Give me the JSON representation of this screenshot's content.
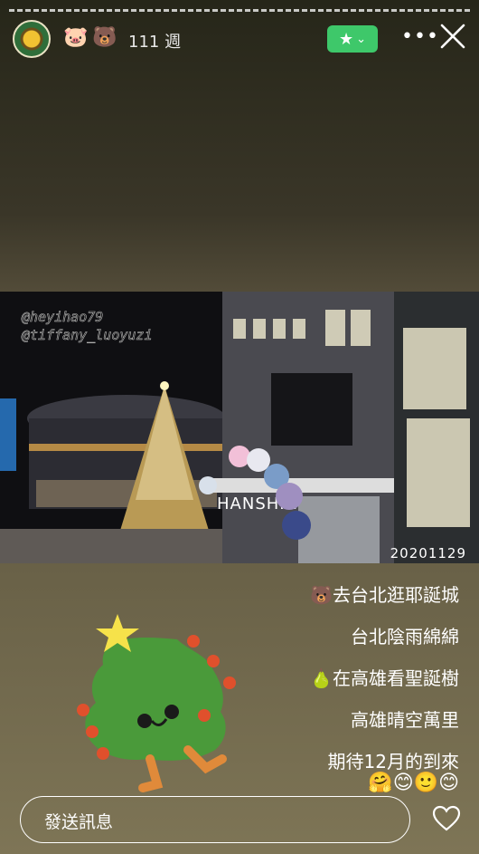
{
  "header": {
    "avatar_icon": "sunflower-avatar",
    "emoji_1": "🐷",
    "emoji_2": "🐻",
    "duration": "111 週",
    "favorite_icon": "star-icon",
    "favorite_color": "#3ec86a",
    "more_label": "•••",
    "close_icon": "close-icon"
  },
  "photo": {
    "watermark_1": "@heyihao79",
    "watermark_2": "@tiffany_luoyuzi",
    "date_stamp": "20201129",
    "store_sign": "HANSHIN"
  },
  "caption": {
    "lines": [
      "🐻去台北逛耶誕城",
      "台北陰雨綿綿",
      "🍐在高雄看聖誕樹",
      "高雄晴空萬里",
      "期待12月的到來"
    ],
    "emojis": "🤗😊🙂😊"
  },
  "sticker": {
    "icon": "christmas-tree-sticker"
  },
  "reply": {
    "placeholder": "發送訊息",
    "like_icon": "heart-icon"
  }
}
